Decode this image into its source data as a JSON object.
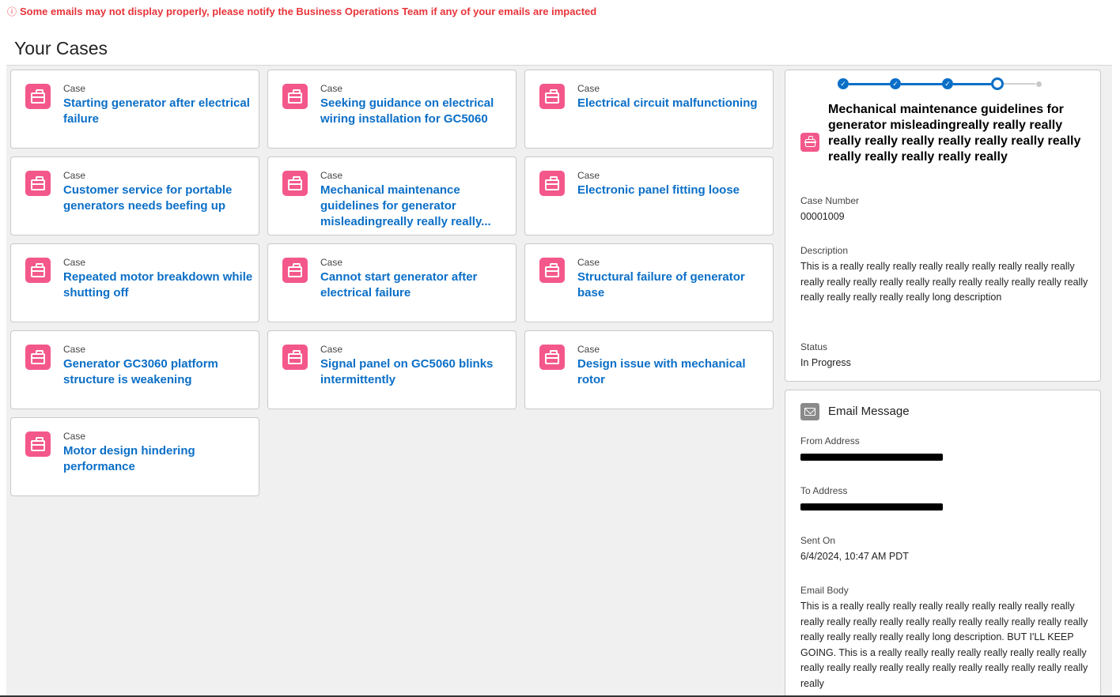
{
  "banner": {
    "icon": "info-circle-icon",
    "text": "Some emails may not display properly, please notify the Business Operations Team if any of your emails are impacted",
    "color": "#e8343a"
  },
  "page_title": "Your Cases",
  "colors": {
    "accent": "#0b6fc7",
    "case_icon": "#f4588b"
  },
  "cases": [
    {
      "label": "Case",
      "title": "Starting generator after electrical failure"
    },
    {
      "label": "Case",
      "title": "Seeking guidance on electrical wiring installation for GC5060"
    },
    {
      "label": "Case",
      "title": "Electrical circuit malfunctioning"
    },
    {
      "label": "Case",
      "title": "Customer service for portable generators needs beefing up"
    },
    {
      "label": "Case",
      "title": "Mechanical maintenance guidelines for generator misleadingreally really really..."
    },
    {
      "label": "Case",
      "title": "Electronic panel fitting loose"
    },
    {
      "label": "Case",
      "title": "Repeated motor breakdown while shutting off"
    },
    {
      "label": "Case",
      "title": "Cannot start generator after electrical failure"
    },
    {
      "label": "Case",
      "title": "Structural failure of generator base"
    },
    {
      "label": "Case",
      "title": "Generator GC3060 platform structure is weakening"
    },
    {
      "label": "Case",
      "title": "Signal panel on GC5060 blinks intermittently"
    },
    {
      "label": "Case",
      "title": "Design issue with mechanical rotor"
    },
    {
      "label": "Case",
      "title": "Motor design hindering performance"
    }
  ],
  "detail": {
    "path_steps": [
      "complete",
      "complete",
      "complete",
      "current",
      "future"
    ],
    "title": "Mechanical maintenance guidelines for generator misleadingreally really really really really really really really really really really really really really really",
    "case_number_label": "Case Number",
    "case_number": "00001009",
    "description_label": "Description",
    "description": "This is a really really really really really really really really really really really really really really really really really really really really really really really really really long description",
    "status_label": "Status",
    "status": "In Progress"
  },
  "email": {
    "heading": "Email Message",
    "icon": "envelope-icon",
    "from_label": "From Address",
    "to_label": "To Address",
    "sent_on_label": "Sent On",
    "sent_on": "6/4/2024, 10:47 AM PDT",
    "body_label": "Email Body",
    "body": "This is a really really really really really really really really really really really really really really really really really really really really really really really really really long description. BUT I'LL KEEP GOING. This is a really really really really really really really really really really really really really really really really really really really really"
  }
}
